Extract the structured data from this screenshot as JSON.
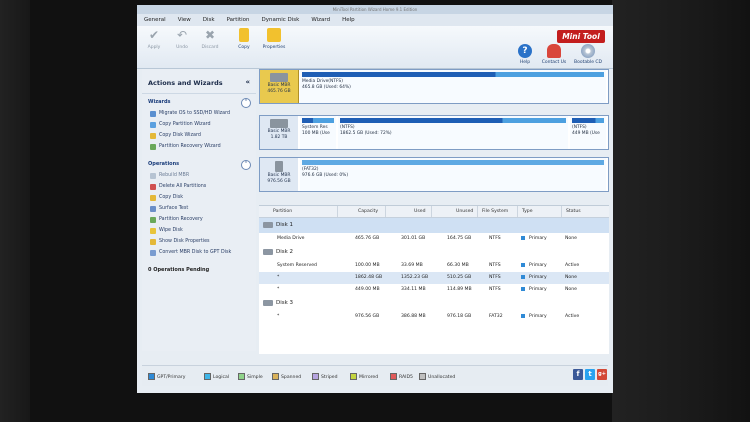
{
  "app": {
    "window_title": "MiniTool Partition Wizard Home 9.1 Edition",
    "logo": "Mini Tool"
  },
  "menu": [
    "General",
    "View",
    "Disk",
    "Partition",
    "Dynamic Disk",
    "Wizard",
    "Help"
  ],
  "toolbar": {
    "apply": "Apply",
    "undo": "Undo",
    "discard": "Discard",
    "copy": "Copy",
    "properties": "Properties",
    "help": "Help",
    "contact": "Contact Us",
    "bootable": "Bootable CD"
  },
  "left_panel": {
    "title": "Actions and Wizards",
    "wizards_title": "Wizards",
    "wizards": [
      "Migrate OS to SSD/HD Wizard",
      "Copy Partition Wizard",
      "Copy Disk Wizard",
      "Partition Recovery Wizard"
    ],
    "operations_title": "Operations",
    "operations": [
      "Rebuild MBR",
      "Delete All Partitions",
      "Copy Disk",
      "Surface Test",
      "Partition Recovery",
      "Wipe Disk",
      "Show Disk Properties",
      "Convert MBR Disk to GPT Disk"
    ],
    "pending": "0 Operations Pending"
  },
  "disk_map": [
    {
      "type": "Basic MBR",
      "size": "465.76 GB",
      "partitions": [
        {
          "name": "Media Drive(NTFS)",
          "detail": "465.8 GB (Used: 64%)",
          "used": 0.64
        }
      ]
    },
    {
      "type": "Basic MBR",
      "size": "1.82 TB",
      "partitions": [
        {
          "name": "System Res",
          "detail": "100 MB (Use",
          "used": 0.34
        },
        {
          "name": "(NTFS)",
          "detail": "1862.5 GB (Used: 72%)",
          "used": 0.72
        },
        {
          "name": "(NTFS)",
          "detail": "449 MB (Use",
          "used": 0.74
        }
      ]
    },
    {
      "type": "Basic MBR",
      "size": "976.56 GB",
      "partitions": [
        {
          "name": "(FAT32)",
          "detail": "976.6 GB (Used: 0%)",
          "used": 0.0
        }
      ]
    }
  ],
  "table": {
    "columns": [
      "Partition",
      "Capacity",
      "Used",
      "Unused",
      "File System",
      "Type",
      "Status"
    ],
    "disks": [
      {
        "name": "Disk 1",
        "rows": [
          [
            "Media Drive",
            "465.76 GB",
            "301.01 GB",
            "164.75 GB",
            "NTFS",
            "Primary",
            "None"
          ]
        ]
      },
      {
        "name": "Disk 2",
        "rows": [
          [
            "System Reserved",
            "100.00 MB",
            "33.69 MB",
            "66.30 MB",
            "NTFS",
            "Primary",
            "Active"
          ],
          [
            "*",
            "1862.48 GB",
            "1352.23 GB",
            "510.25 GB",
            "NTFS",
            "Primary",
            "None"
          ],
          [
            "*",
            "449.00 MB",
            "334.11 MB",
            "114.89 MB",
            "NTFS",
            "Primary",
            "None"
          ]
        ]
      },
      {
        "name": "Disk 3",
        "rows": [
          [
            "*",
            "976.56 GB",
            "386.88 MB",
            "976.18 GB",
            "FAT32",
            "Primary",
            "Active"
          ]
        ]
      }
    ]
  },
  "legend": [
    "GPT/Primary",
    "Logical",
    "Simple",
    "Spanned",
    "Striped",
    "Mirrored",
    "RAID5",
    "Unallocated"
  ],
  "legend_colors": [
    "#2f8ad6",
    "#3fb5e8",
    "#8fd38a",
    "#d9b25b",
    "#b6a4e0",
    "#c3d43f",
    "#e05a5a",
    "#bfbfbf"
  ],
  "social": [
    "f",
    "t",
    "g+"
  ]
}
